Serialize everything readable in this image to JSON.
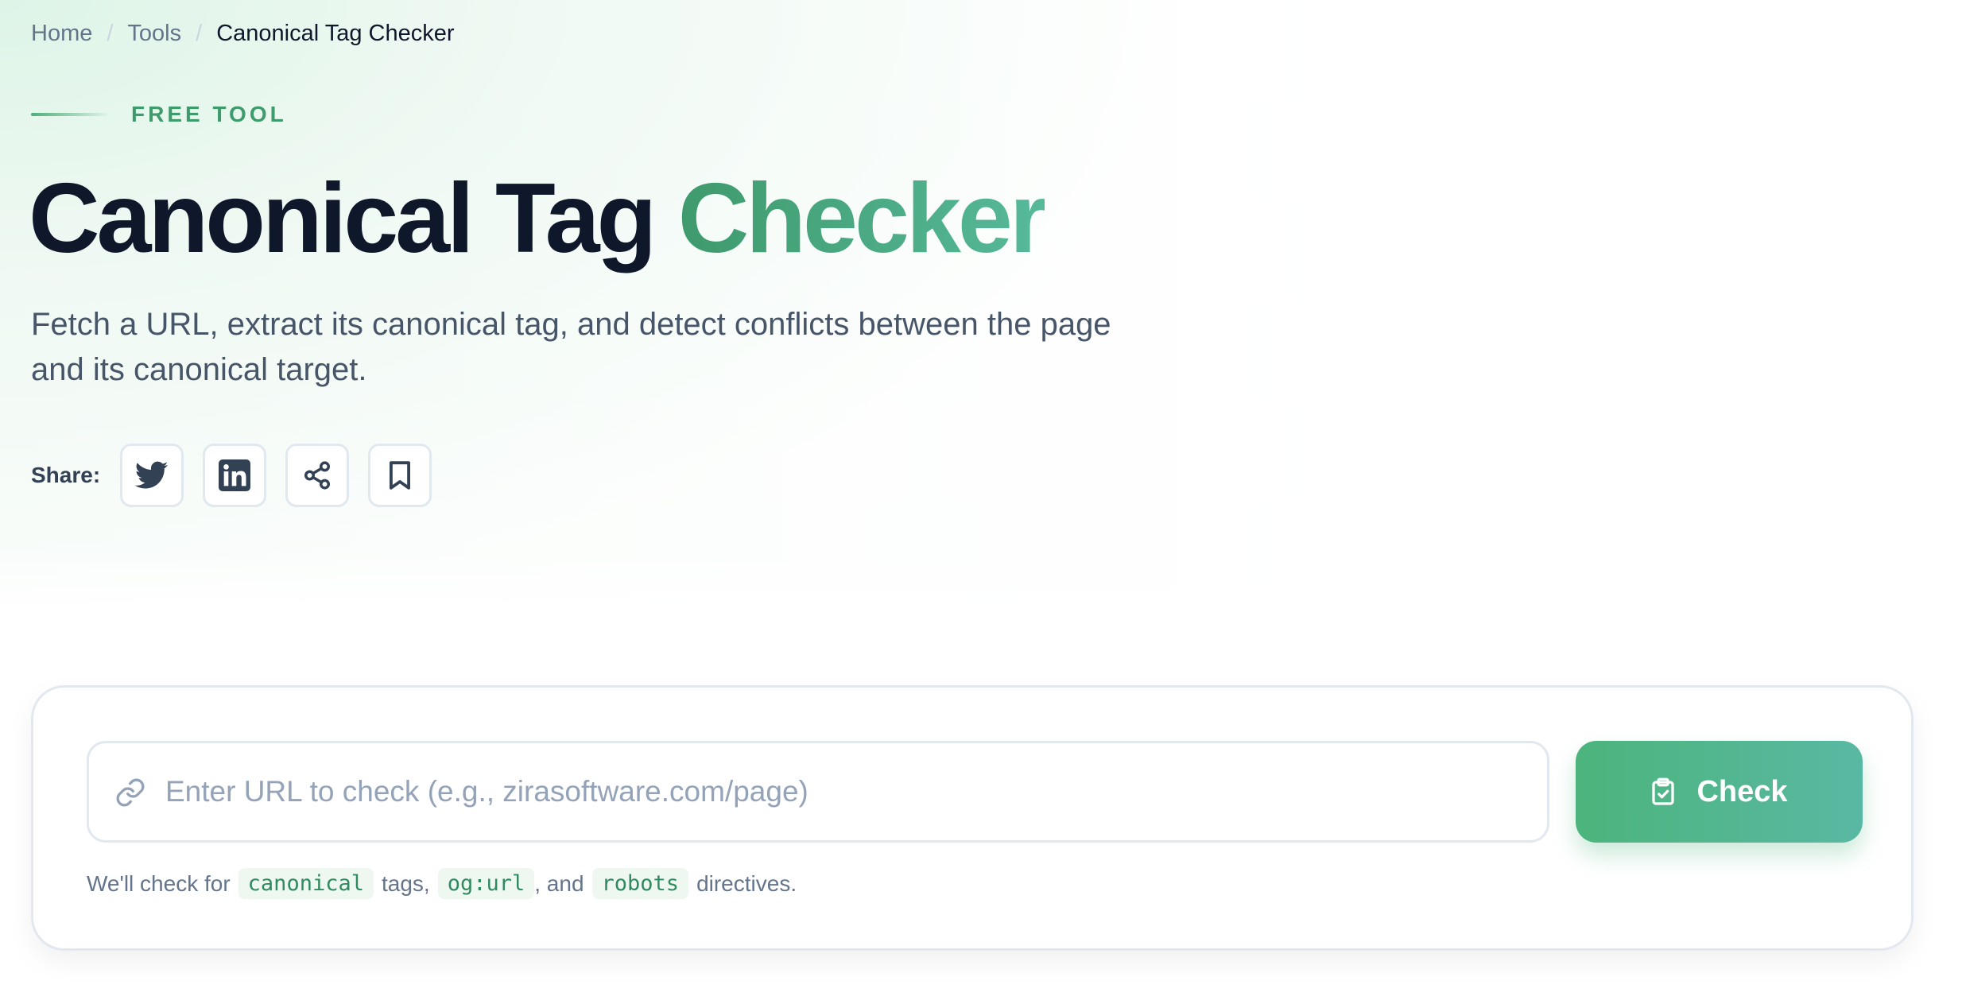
{
  "breadcrumb": {
    "items": [
      "Home",
      "Tools"
    ],
    "separator": "/",
    "current": "Canonical Tag Checker"
  },
  "hero": {
    "eyebrow": "FREE TOOL",
    "title_dark": "Canonical Tag",
    "title_accent": "Checker",
    "description": "Fetch a URL, extract its canonical tag, and detect conflicts between the page and its canonical target."
  },
  "share": {
    "label": "Share:",
    "buttons": [
      {
        "icon": "twitter-icon"
      },
      {
        "icon": "linkedin-icon"
      },
      {
        "icon": "share-icon"
      },
      {
        "icon": "bookmark-icon"
      }
    ]
  },
  "checker": {
    "input_placeholder": "Enter URL to check (e.g., zirasoftware.com/page)",
    "input_value": "",
    "check_label": "Check",
    "hint": {
      "prefix": "We'll check for",
      "code1": "canonical",
      "mid1": "tags,",
      "code2": "og:url",
      "mid2": ", and",
      "code3": "robots",
      "suffix": "directives."
    }
  },
  "colors": {
    "accent": "#4cb47c",
    "accent_end": "#59b8a3",
    "title_dark": "#0f172a",
    "text_muted": "#64748b"
  }
}
